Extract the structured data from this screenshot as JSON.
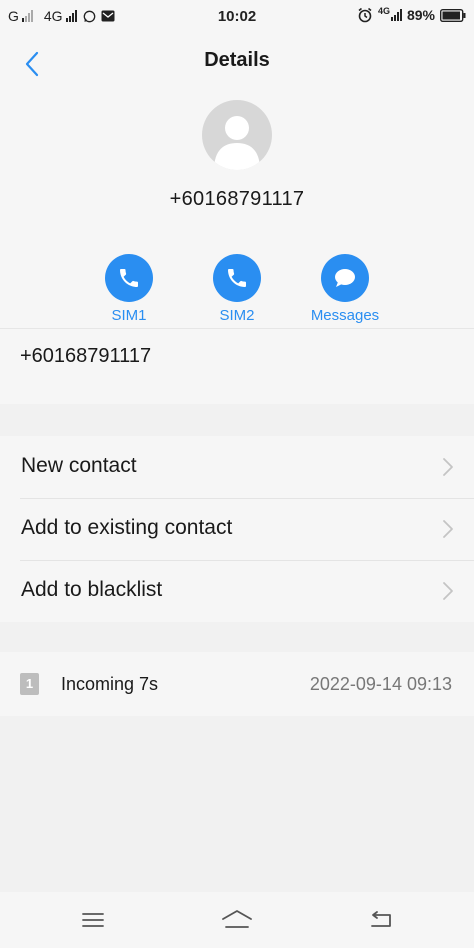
{
  "status_bar": {
    "carrier1": "G",
    "carrier2": "4G",
    "time": "10:02",
    "network_badge": "4G",
    "battery": "89%"
  },
  "header": {
    "title": "Details"
  },
  "profile": {
    "phone_number": "+60168791117"
  },
  "actions": [
    {
      "label": "SIM1",
      "icon": "phone-icon"
    },
    {
      "label": "SIM2",
      "icon": "phone-icon"
    },
    {
      "label": "Messages",
      "icon": "message-icon"
    }
  ],
  "number_row": {
    "value": "+60168791117"
  },
  "options": [
    {
      "label": "New contact"
    },
    {
      "label": "Add to existing contact"
    },
    {
      "label": "Add to blacklist"
    }
  ],
  "call_log": {
    "sim": "1",
    "type": "Incoming 7s",
    "datetime": "2022-09-14 09:13"
  },
  "colors": {
    "accent": "#2a8ef1",
    "background": "#f1f1f1",
    "card": "#f6f6f6"
  }
}
